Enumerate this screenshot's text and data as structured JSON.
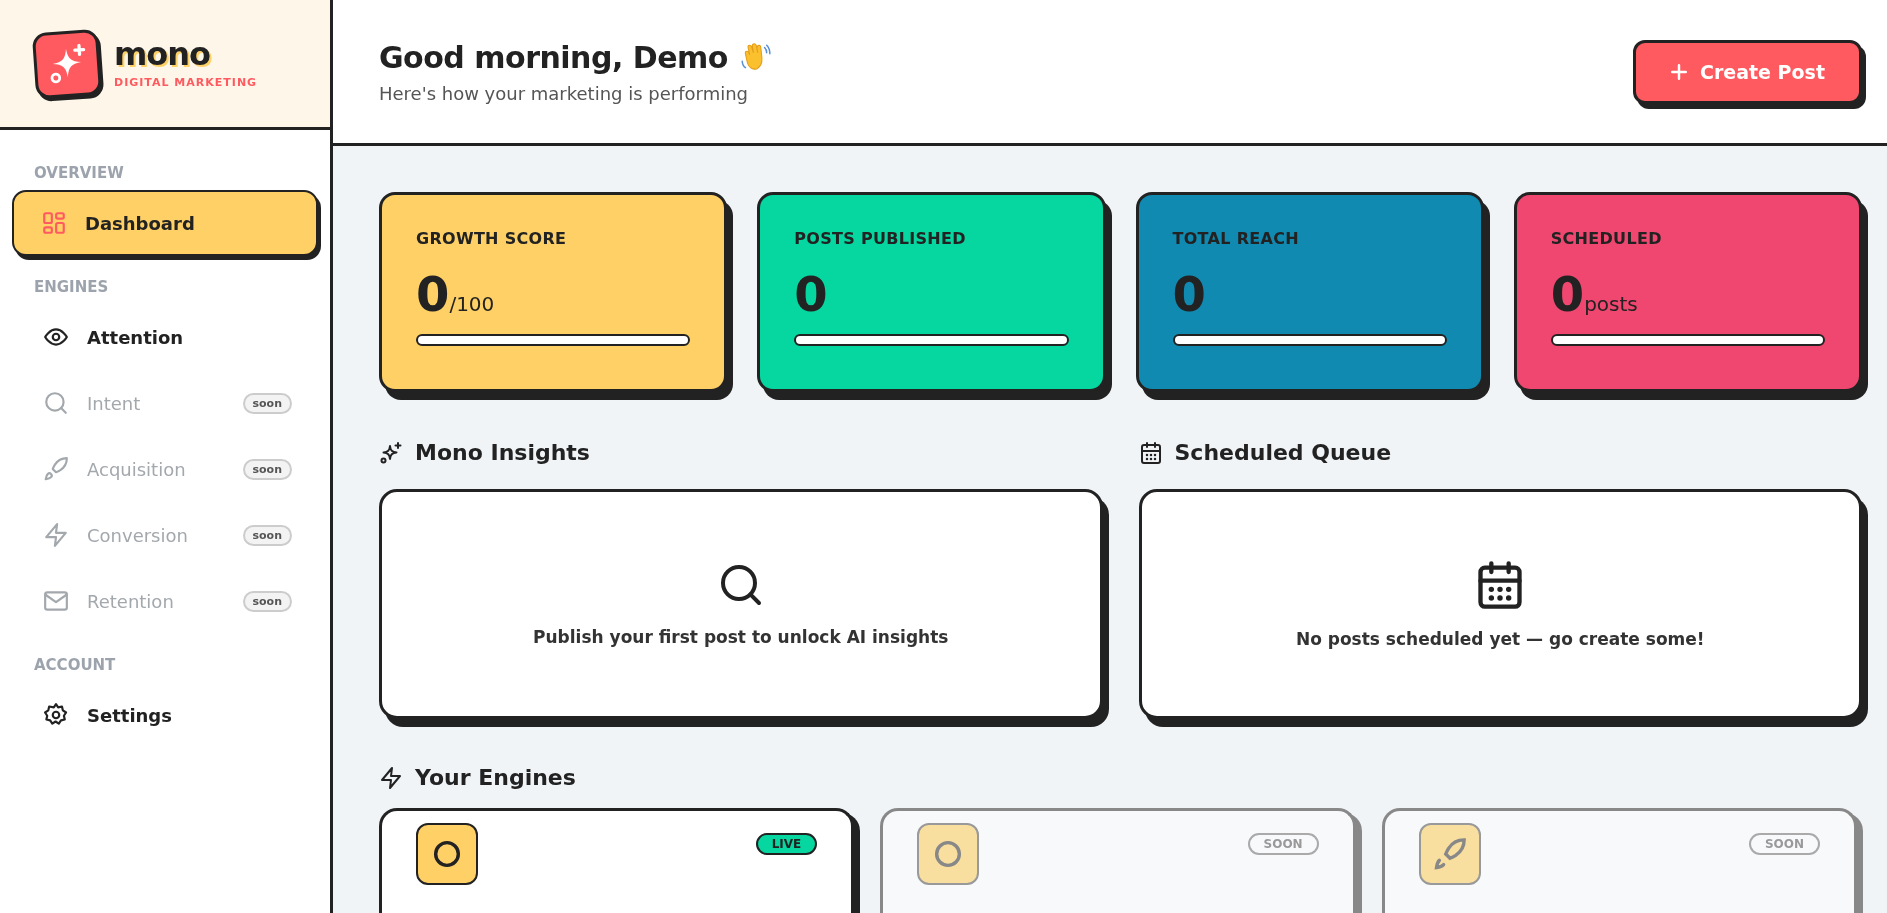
{
  "brand": {
    "name": "mono",
    "tagline": "DIGITAL MARKETING"
  },
  "sidebar": {
    "sections": [
      {
        "label": "OVERVIEW",
        "items": [
          {
            "label": "Dashboard",
            "selected": true,
            "disabled": false
          }
        ]
      },
      {
        "label": "ENGINES",
        "items": [
          {
            "label": "Attention",
            "selected": false,
            "disabled": false
          },
          {
            "label": "Intent",
            "selected": false,
            "disabled": true,
            "badge": "soon"
          },
          {
            "label": "Acquisition",
            "selected": false,
            "disabled": true,
            "badge": "soon"
          },
          {
            "label": "Conversion",
            "selected": false,
            "disabled": true,
            "badge": "soon"
          },
          {
            "label": "Retention",
            "selected": false,
            "disabled": true,
            "badge": "soon"
          }
        ]
      },
      {
        "label": "ACCOUNT",
        "items": [
          {
            "label": "Settings",
            "selected": false,
            "disabled": false
          }
        ]
      }
    ]
  },
  "header": {
    "title": "Good morning, Demo",
    "subtitle": "Here's how your marketing is performing",
    "action": "Create Post"
  },
  "stats": [
    {
      "label": "GROWTH SCORE",
      "value": "0",
      "unit": "/100",
      "color": "#fed066",
      "level": 0
    },
    {
      "label": "POSTS PUBLISHED",
      "value": "0",
      "color": "#06d6a0",
      "level": 0
    },
    {
      "label": "TOTAL REACH",
      "value": "0",
      "color": "#118ab2",
      "level": 0
    },
    {
      "label": "SCHEDULED",
      "value": "0",
      "unit": "posts",
      "color": "#ef476f",
      "level": 0
    }
  ],
  "panels": [
    {
      "title": "Mono Insights",
      "message": "Publish your first post to unlock AI insights"
    },
    {
      "title": "Scheduled Queue",
      "message": "No posts scheduled yet — go create some!"
    }
  ],
  "engines": {
    "title": "Your Engines",
    "cards": [
      {
        "badge": "LIVE",
        "live": true
      },
      {
        "badge": "SOON",
        "live": false
      },
      {
        "badge": "SOON",
        "live": false
      }
    ]
  }
}
